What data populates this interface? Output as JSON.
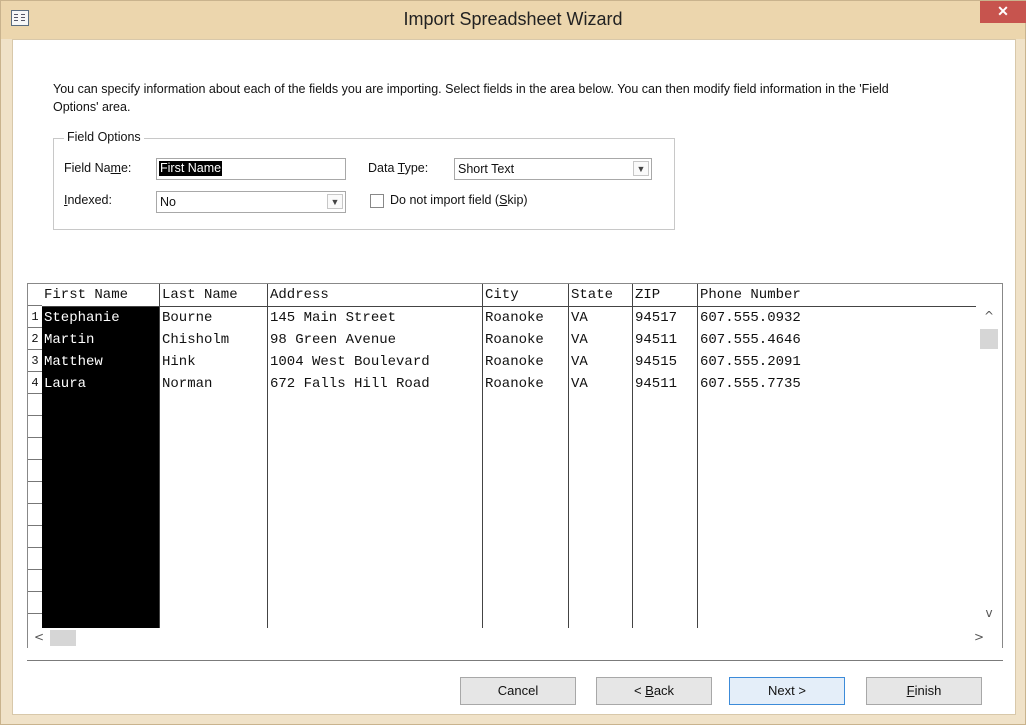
{
  "window": {
    "title": "Import Spreadsheet Wizard",
    "close_label": "✕"
  },
  "instructions": "You can specify information about each of the fields you are importing. Select fields in the area below. You can then modify field information in the 'Field Options' area.",
  "field_options": {
    "legend": "Field Options",
    "field_name_label": "Field Name:",
    "field_name_value": "First Name",
    "data_type_label": "Data Type:",
    "data_type_value": "Short Text",
    "indexed_label": "Indexed:",
    "indexed_value": "No",
    "skip_label": "Do not import field (Skip)",
    "skip_checked": false
  },
  "grid": {
    "columns": [
      "First Name",
      "Last Name",
      "Address",
      "City",
      "State",
      "ZIP",
      "Phone Number"
    ],
    "selected_column": "First Name",
    "row_numbers": [
      "1",
      "2",
      "3",
      "4"
    ],
    "rows": [
      [
        "Stephanie",
        "Bourne",
        "145 Main Street",
        "Roanoke",
        "VA",
        "94517",
        "607.555.0932"
      ],
      [
        "Martin",
        "Chisholm",
        "98 Green Avenue",
        "Roanoke",
        "VA",
        "94511",
        "607.555.4646"
      ],
      [
        "Matthew",
        "Hink",
        "1004 West Boulevard",
        "Roanoke",
        "VA",
        "94515",
        "607.555.2091"
      ],
      [
        "Laura",
        "Norman",
        "672 Falls Hill Road",
        "Roanoke",
        "VA",
        "94511",
        "607.555.7735"
      ]
    ]
  },
  "buttons": {
    "cancel": "Cancel",
    "back": "< Back",
    "next": "Next >",
    "finish": "Finish"
  }
}
